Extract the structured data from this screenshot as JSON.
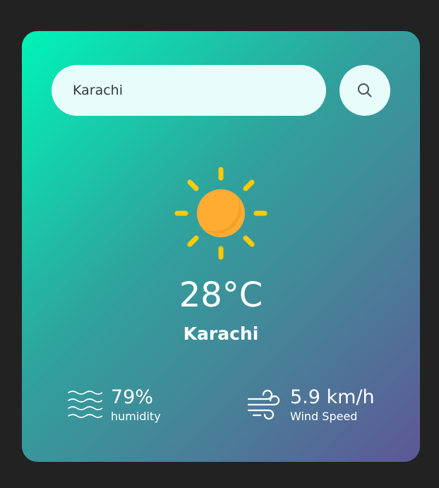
{
  "search": {
    "value": "Karachi",
    "button_icon": "search-icon"
  },
  "weather": {
    "icon": "sun-icon",
    "temperature": "28°C",
    "city": "Karachi"
  },
  "details": {
    "humidity": {
      "icon": "humidity-waves-icon",
      "value": "79%",
      "label": "humidity"
    },
    "wind": {
      "icon": "wind-icon",
      "value": "5.9 km/h",
      "label": "Wind Speed"
    }
  },
  "colors": {
    "page_background": "#222222",
    "gradient_start": "#00f4b8",
    "gradient_end": "#5d5796",
    "field_background": "#e8fcfa",
    "sun_core": "#ffac33",
    "sun_rays": "#ffcb05"
  }
}
